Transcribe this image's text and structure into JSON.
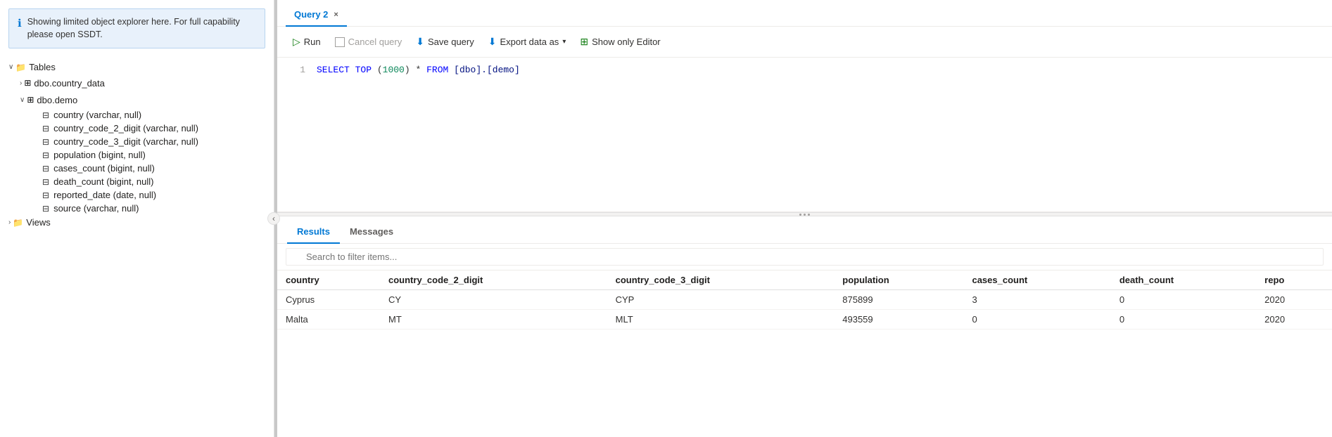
{
  "sidebar": {
    "info_banner": {
      "text": "Showing limited object explorer here. For full capability please open SSDT."
    },
    "tree": {
      "tables_label": "Tables",
      "country_data": "dbo.country_data",
      "demo": "dbo.demo",
      "columns": [
        {
          "name": "country (varchar, null)"
        },
        {
          "name": "country_code_2_digit (varchar, null)"
        },
        {
          "name": "country_code_3_digit (varchar, null)"
        },
        {
          "name": "population (bigint, null)"
        },
        {
          "name": "cases_count (bigint, null)"
        },
        {
          "name": "death_count (bigint, null)"
        },
        {
          "name": "reported_date (date, null)"
        },
        {
          "name": "source (varchar, null)"
        }
      ],
      "views_label": "Views"
    }
  },
  "editor": {
    "tab_label": "Query 2",
    "tab_close": "×",
    "code_line": "SELECT TOP (1000) * FROM [dbo].[demo]",
    "line_number": "1"
  },
  "toolbar": {
    "run_label": "Run",
    "cancel_label": "Cancel query",
    "save_label": "Save query",
    "export_label": "Export data as",
    "show_editor_label": "Show only Editor",
    "chevron_down": "▾"
  },
  "results": {
    "results_tab": "Results",
    "messages_tab": "Messages",
    "search_placeholder": "Search to filter items...",
    "columns": [
      "country",
      "country_code_2_digit",
      "country_code_3_digit",
      "population",
      "cases_count",
      "death_count",
      "repo"
    ],
    "rows": [
      {
        "country": "Cyprus",
        "country_code_2_digit": "CY",
        "country_code_3_digit": "CYP",
        "population": "875899",
        "cases_count": "3",
        "death_count": "0",
        "repo": "2020"
      },
      {
        "country": "Malta",
        "country_code_2_digit": "MT",
        "country_code_3_digit": "MLT",
        "population": "493559",
        "cases_count": "0",
        "death_count": "0",
        "repo": "2020"
      }
    ]
  },
  "colors": {
    "accent": "#0078d4",
    "green": "#107c10",
    "info_bg": "#e8f1fb"
  }
}
